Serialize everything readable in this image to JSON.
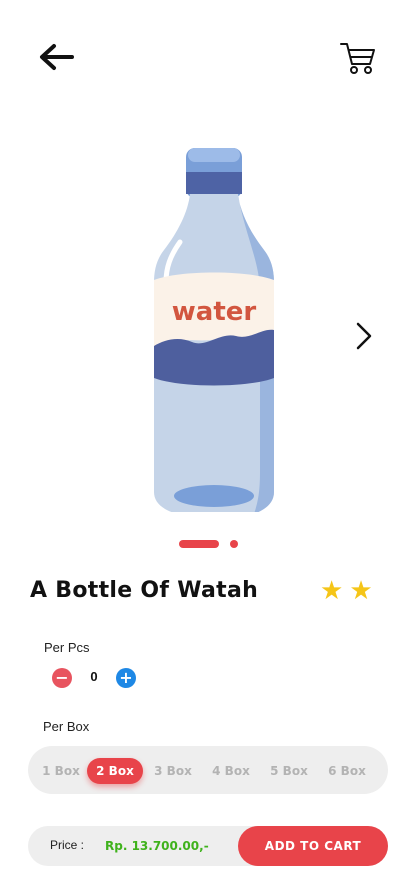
{
  "header": {
    "back_icon": "arrow-left-icon",
    "cart_icon": "shopping-cart-icon"
  },
  "product": {
    "image_label": "water",
    "name": "A Bottle Of Watah",
    "rating": 2,
    "next_icon": "chevron-right-icon",
    "carousel": {
      "count": 2,
      "active_index": 0
    }
  },
  "per_pcs": {
    "label": "Per Pcs",
    "minus": "−",
    "plus": "+",
    "quantity": "0"
  },
  "per_box": {
    "label": "Per Box",
    "options": [
      "1 Box",
      "2 Box",
      "3 Box",
      "4 Box",
      "5 Box",
      "6 Box"
    ],
    "selected_index": 1
  },
  "purchase": {
    "price_label": "Price :",
    "price_value": "Rp. 13.700.00,-",
    "add_to_cart": "ADD TO CART"
  },
  "colors": {
    "accent": "#e8444a",
    "price": "#3fb21c",
    "plus": "#1e88e5",
    "star": "#f5c518"
  }
}
